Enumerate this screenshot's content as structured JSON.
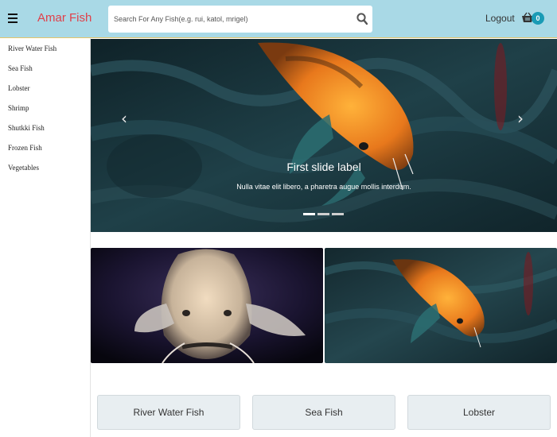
{
  "header": {
    "brand": "Amar Fish",
    "search_placeholder": "Search For Any Fish(e.g. rui, katol, mrigel)",
    "logout_label": "Logout",
    "cart_count": "0",
    "colors": {
      "header_bg": "#a9d9e6",
      "brand": "#e0404a",
      "badge": "#1a9bb5"
    }
  },
  "sidebar": {
    "items": [
      {
        "label": "River Water Fish"
      },
      {
        "label": "Sea Fish"
      },
      {
        "label": "Lobster"
      },
      {
        "label": "Shrimp"
      },
      {
        "label": "Shutkki Fish"
      },
      {
        "label": "Frozen Fish"
      },
      {
        "label": "Vegetables"
      }
    ]
  },
  "carousel": {
    "title": "First slide label",
    "text": "Nulla vitae elit libero, a pharetra augue mollis interdum.",
    "prev_icon": "‹",
    "next_icon": "›",
    "active_slide": 1,
    "slide_count": 3
  },
  "categories": [
    {
      "label": "River Water Fish"
    },
    {
      "label": "Sea Fish"
    },
    {
      "label": "Lobster"
    }
  ]
}
